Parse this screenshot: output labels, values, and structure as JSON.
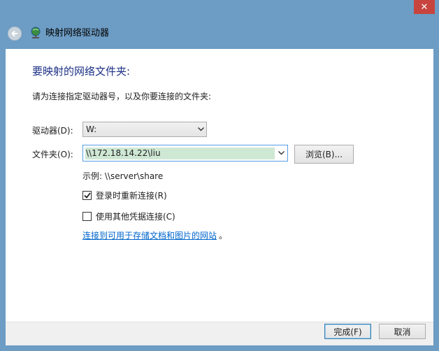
{
  "window": {
    "title": "映射网络驱动器",
    "close_glyph": "✕"
  },
  "icons": {
    "back": "back-arrow-icon",
    "title": "network-drive-icon",
    "close": "close-icon",
    "dropdown": "chevron-down-icon",
    "checkbox_checked": "checkmark-icon"
  },
  "dialog": {
    "heading": "要映射的网络文件夹:",
    "instruction": "请为连接指定驱动器号，以及你要连接的文件夹:",
    "drive_label": "驱动器(D):",
    "drive_value": "W:",
    "folder_label": "文件夹(O):",
    "folder_value": "\\\\172.18.14.22\\liu",
    "browse_label": "浏览(B)...",
    "example": "示例: \\\\server\\share",
    "reconnect_label": "登录时重新连接(R)",
    "reconnect_checked": true,
    "other_credentials_label": "使用其他凭据连接(C)",
    "other_credentials_checked": false,
    "link_text": "连接到可用于存储文档和图片的网站",
    "link_suffix": "。"
  },
  "footer": {
    "finish_label": "完成(F)",
    "cancel_label": "取消"
  },
  "colors": {
    "title_bar": "#6d9cc4",
    "heading": "#1e3287",
    "link": "#0066cc",
    "close": "#c7453e",
    "selection": "#cfe8d4"
  }
}
